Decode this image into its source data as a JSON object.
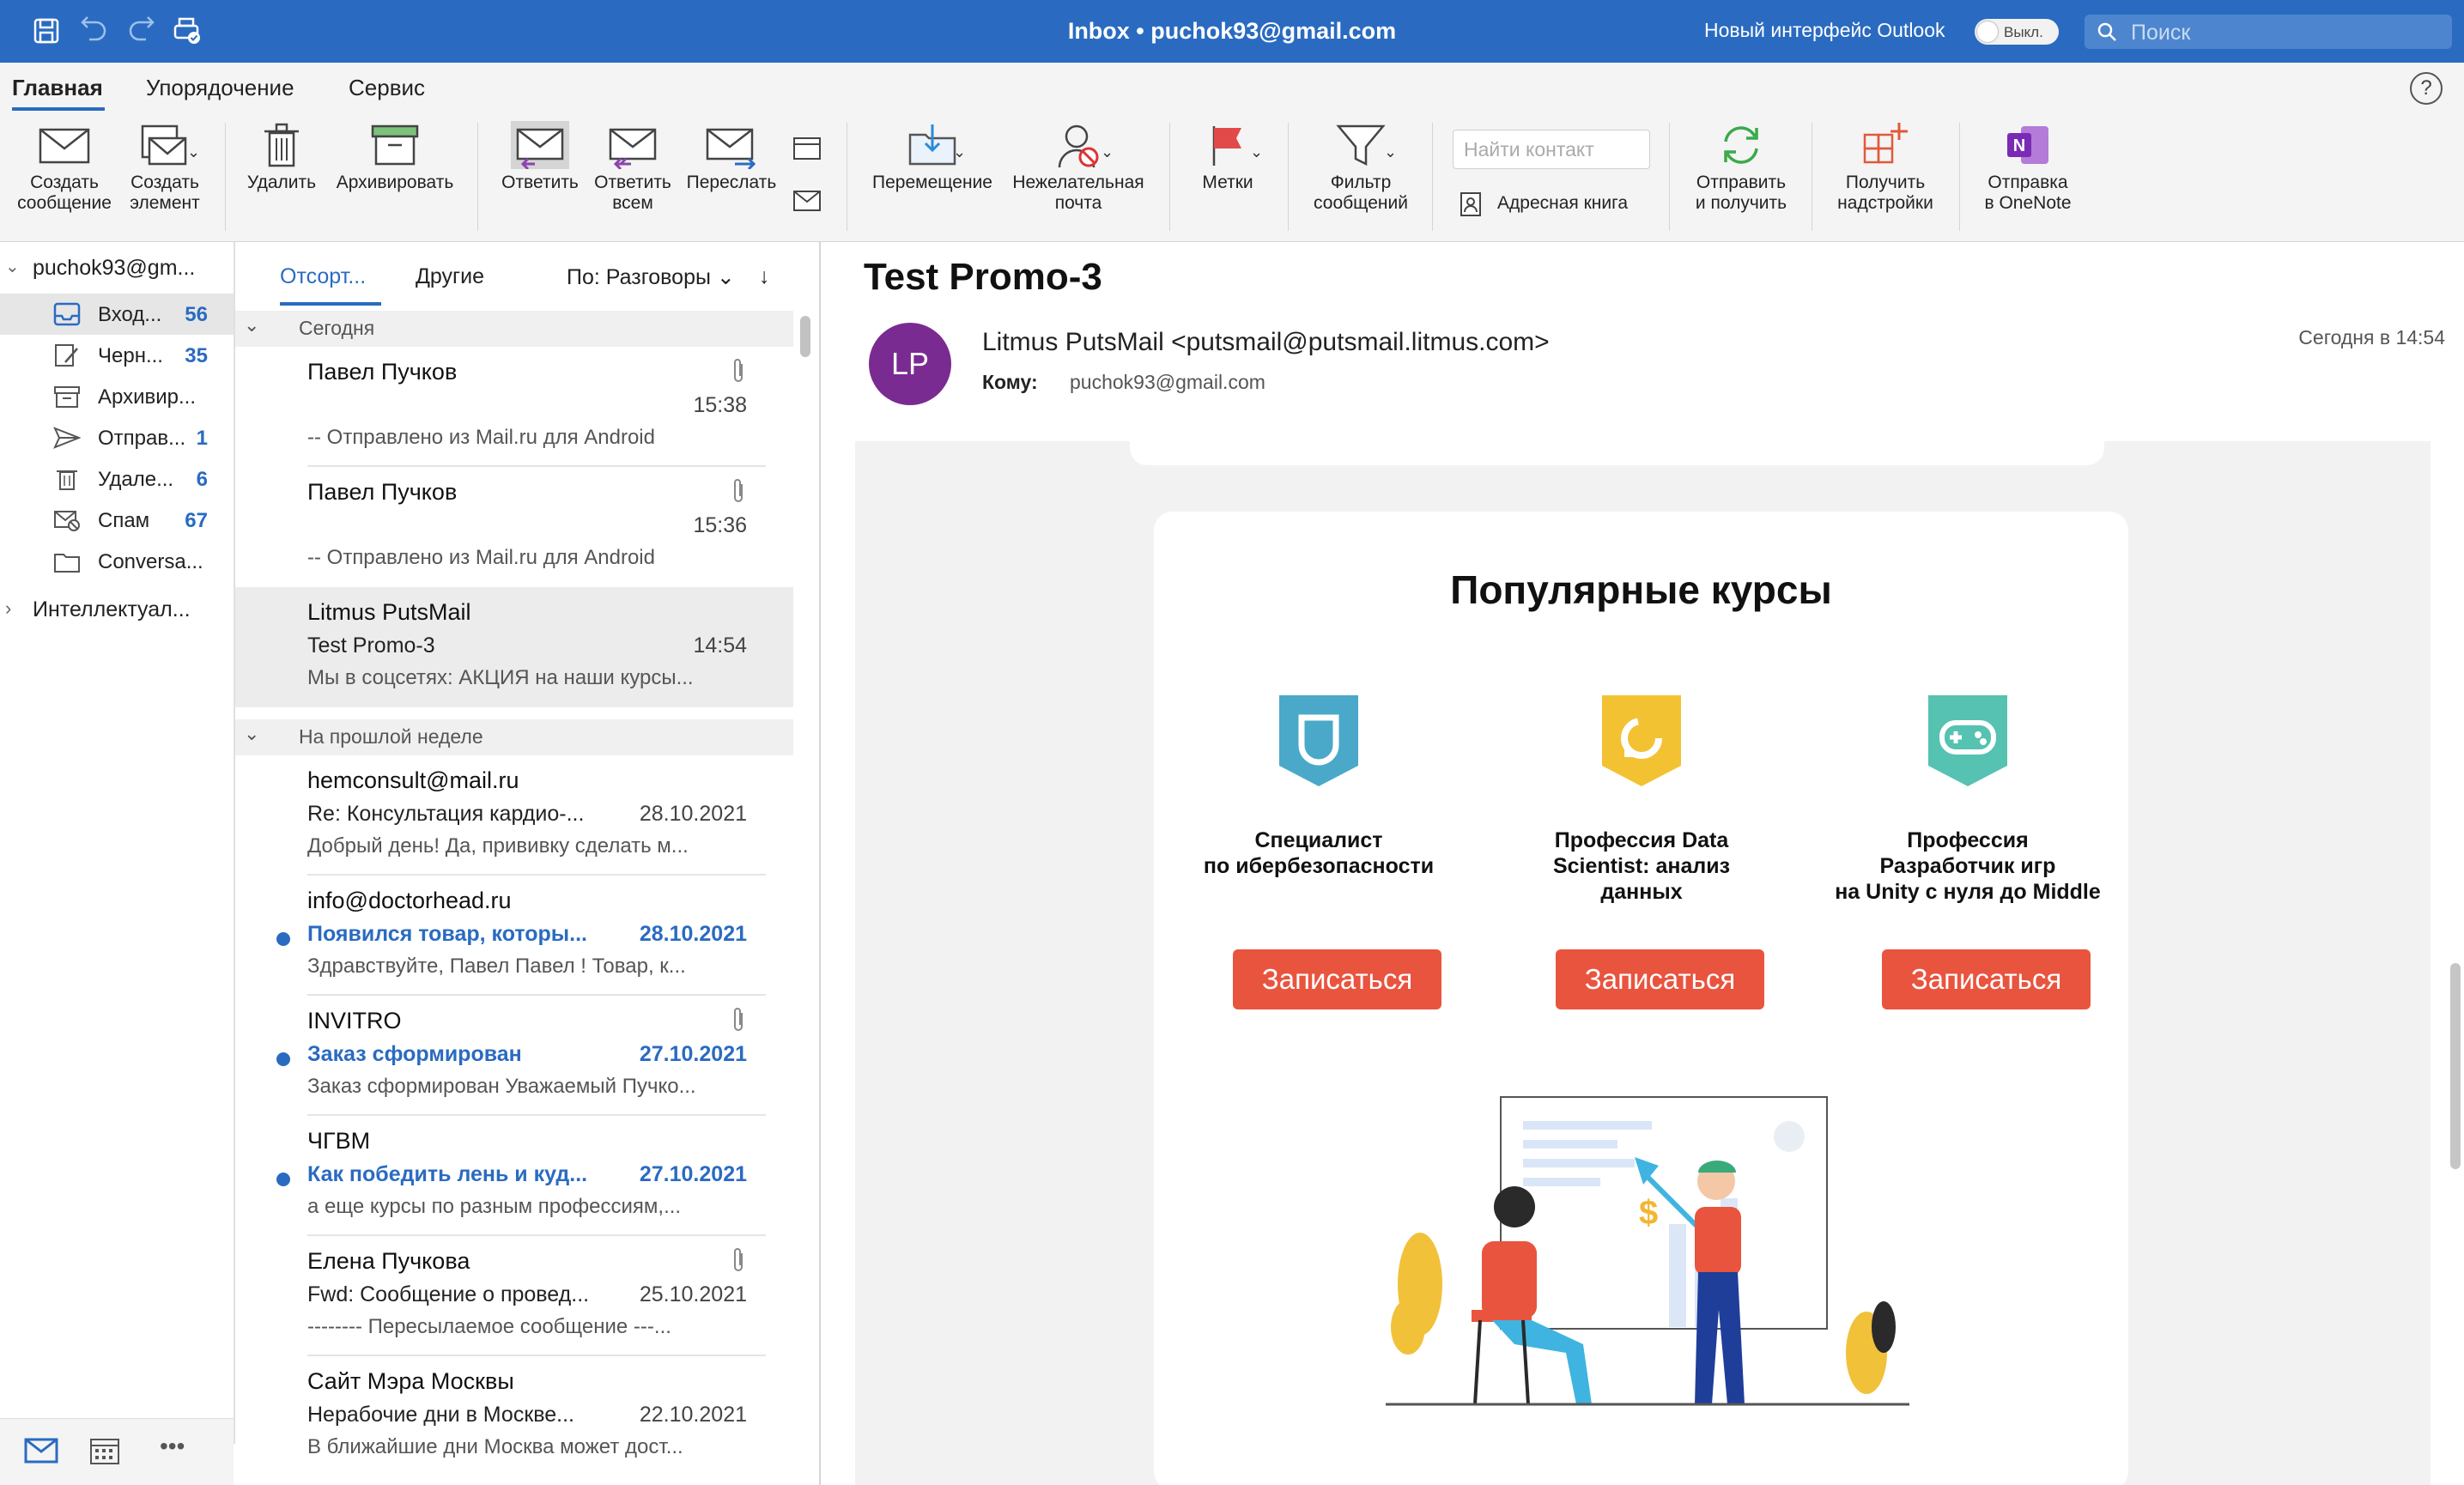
{
  "titlebar": {
    "title": "Inbox • puchok93@gmail.com",
    "new_ui_label": "Новый интерфейс Outlook",
    "toggle_label": "Выкл.",
    "search_placeholder": "Поиск"
  },
  "ribbon_tabs": [
    {
      "label": "Главная",
      "active": true
    },
    {
      "label": "Упорядочение",
      "active": false
    },
    {
      "label": "Сервис",
      "active": false
    }
  ],
  "ribbon": {
    "new_message": [
      "Создать",
      "сообщение"
    ],
    "new_item": [
      "Создать",
      "элемент"
    ],
    "delete": "Удалить",
    "archive": "Архивировать",
    "reply": "Ответить",
    "reply_all": [
      "Ответить",
      "всем"
    ],
    "forward": "Переслать",
    "move": "Перемещение",
    "junk": [
      "Нежелательная",
      "почта"
    ],
    "flags": "Метки",
    "filter": [
      "Фильтр",
      "сообщений"
    ],
    "find_contact_placeholder": "Найти контакт",
    "address_book": "Адресная книга",
    "send_receive": [
      "Отправить",
      "и получить"
    ],
    "get_addins": [
      "Получить",
      "надстройки"
    ],
    "send_onenote": [
      "Отправка",
      "в OneNote"
    ]
  },
  "folders": {
    "account": "puchok93@gm...",
    "items": [
      {
        "label": "Вход...",
        "count": "56",
        "icon": "inbox-icon"
      },
      {
        "label": "Черн...",
        "count": "35",
        "icon": "drafts-icon"
      },
      {
        "label": "Архивир...",
        "count": "",
        "icon": "archive-icon"
      },
      {
        "label": "Отправ...",
        "count": "1",
        "icon": "sent-icon"
      },
      {
        "label": "Удале...",
        "count": "6",
        "icon": "trash-icon"
      },
      {
        "label": "Спам",
        "count": "67",
        "icon": "spam-icon"
      },
      {
        "label": "Conversa...",
        "count": "",
        "icon": "folder-icon"
      }
    ],
    "second_account": "Интеллектуал..."
  },
  "list": {
    "tab_focused": "Отсорт...",
    "tab_other": "Другие",
    "sort_label": "По: Разговоры",
    "groups": {
      "today": "Сегодня",
      "last_week": "На прошлой неделе"
    },
    "today": [
      {
        "sender": "Павел Пучков",
        "subject": "",
        "date": "15:38",
        "preview": "-- Отправлено из Mail.ru для Android",
        "attachment": true,
        "unread": false
      },
      {
        "sender": "Павел Пучков",
        "subject": "",
        "date": "15:36",
        "preview": "-- Отправлено из Mail.ru для Android",
        "attachment": true,
        "unread": false
      },
      {
        "sender": "Litmus PutsMail",
        "subject": "Test Promo-3",
        "date": "14:54",
        "preview": "Мы в соцсетях: АКЦИЯ на наши курсы...",
        "attachment": false,
        "unread": false,
        "selected": true
      }
    ],
    "last_week": [
      {
        "sender": "hemconsult@mail.ru",
        "subject": "Re: Консультация кардио-...",
        "date": "28.10.2021",
        "preview": "Добрый день! Да, прививку сделать м...",
        "attachment": false,
        "unread": false
      },
      {
        "sender": "info@doctorhead.ru",
        "subject": "Появился товар, которы...",
        "date": "28.10.2021",
        "preview": "Здравствуйте, Павел Павел ! Товар, к...",
        "attachment": false,
        "unread": true
      },
      {
        "sender": "INVITRO",
        "subject": "Заказ сформирован",
        "date": "27.10.2021",
        "preview": "Заказ сформирован Уважаемый Пучко...",
        "attachment": true,
        "unread": true
      },
      {
        "sender": "ЧГВМ",
        "subject": "Как победить лень и куд...",
        "date": "27.10.2021",
        "preview": "а еще курсы по разным профессиям,...",
        "attachment": false,
        "unread": true
      },
      {
        "sender": "Елена Пучкова",
        "subject": "Fwd: Сообщение о провед...",
        "date": "25.10.2021",
        "preview": "-------- Пересылаемое сообщение ---...",
        "attachment": true,
        "unread": false
      },
      {
        "sender": "Сайт Мэра Москвы",
        "subject": "Нерабочие дни в Москве...",
        "date": "22.10.2021",
        "preview": "В ближайшие дни Москва может дост...",
        "attachment": false,
        "unread": false
      }
    ]
  },
  "reading": {
    "subject": "Test Promo-3",
    "avatar_initials": "LP",
    "from": "Litmus PutsMail <putsmail@putsmail.litmus.com>",
    "to_label": "Кому:",
    "to": "puchok93@gmail.com",
    "received": "Сегодня в 14:54",
    "card_title": "Популярные курсы",
    "courses": [
      {
        "title": [
          "Специалист",
          "по ибербезопасности"
        ],
        "button": "Записаться",
        "color": "#4aa9c9"
      },
      {
        "title": [
          "Профессия Data",
          "Scientist: анализ",
          "данных"
        ],
        "button": "Записаться",
        "color": "#f3c233"
      },
      {
        "title": [
          "Профессия",
          "Разработчик игр",
          "на Unity с нуля до Middle"
        ],
        "button": "Записаться",
        "color": "#56c2b1"
      }
    ]
  },
  "colors": {
    "accent": "#2a6bc1",
    "cta": "#e9543f",
    "avatar": "#7a2b91"
  }
}
